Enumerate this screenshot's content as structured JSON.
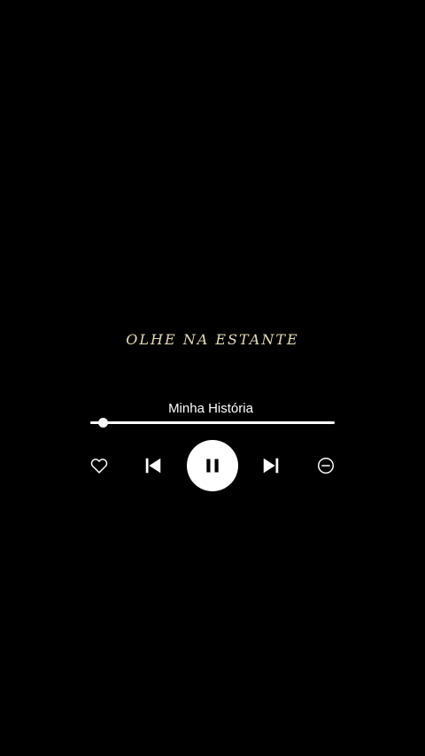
{
  "lyric": {
    "text": "OLHE NA ESTANTE"
  },
  "player": {
    "track_title": "Minha História",
    "progress_fraction": 0.05,
    "state": "playing"
  },
  "icons": {
    "like": "heart-icon",
    "previous": "skip-previous-icon",
    "pause": "pause-icon",
    "next": "skip-next-icon",
    "remove": "minus-circle-icon"
  },
  "colors": {
    "background": "#000000",
    "lyric_text": "#e6dcb4",
    "foreground": "#ffffff"
  }
}
